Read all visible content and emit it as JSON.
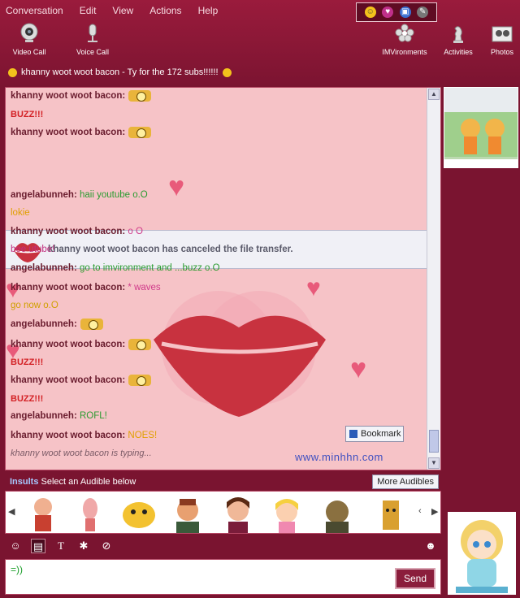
{
  "menu": [
    "Conversation",
    "Edit",
    "View",
    "Actions",
    "Help"
  ],
  "toolbar": {
    "video_call": "Video Call",
    "voice_call": "Voice Call",
    "imvironments": "IMVironments",
    "activities": "Activities",
    "photos": "Photos"
  },
  "status": {
    "text": "khanny woot woot bacon - Ty for the 172 subs!!!!!!"
  },
  "chat": {
    "messages": [
      {
        "name": "khanny woot woot bacon:",
        "text": ""
      },
      {
        "name": "",
        "text": "BUZZ!!!"
      },
      {
        "name": "khanny woot woot bacon:",
        "text": ""
      },
      {
        "name": "angelabunneh:",
        "text": "haii youtube o.O"
      },
      {
        "name": "",
        "text": "lokie"
      },
      {
        "name": "khanny woot woot bacon:",
        "text": "o O"
      },
      {
        "name": "",
        "text": "bee utube!"
      },
      {
        "name": "angelabunneh:",
        "text": "go to imvironment and ...buzz o.O"
      },
      {
        "name": "khanny woot woot bacon:",
        "text": "* waves"
      },
      {
        "name": "",
        "text": "go now o.O"
      },
      {
        "name": "angelabunneh:",
        "text": ""
      },
      {
        "name": "khanny woot woot bacon:",
        "text": ""
      },
      {
        "name": "",
        "text": "BUZZ!!!"
      },
      {
        "name": "khanny woot woot bacon:",
        "text": ""
      },
      {
        "name": "",
        "text": "BUZZ!!!"
      },
      {
        "name": "angelabunneh:",
        "text": "ROFL!"
      },
      {
        "name": "khanny woot woot bacon:",
        "text": "NOES!"
      }
    ],
    "file_notice": "khanny woot woot bacon has canceled the file transfer.",
    "bookmark_label": "Bookmark",
    "watermark": "www.minhhn.com",
    "typing": "khanny woot woot bacon is typing..."
  },
  "audibles": {
    "category": "Insults",
    "prompt": "Select an Audible below",
    "more_label": "More Audibles"
  },
  "input": {
    "value": "=))",
    "send_label": "Send"
  },
  "colors": {
    "chrome": "#7a1430",
    "chat_bg": "#f6c3c7",
    "buzz": "#d32024"
  }
}
